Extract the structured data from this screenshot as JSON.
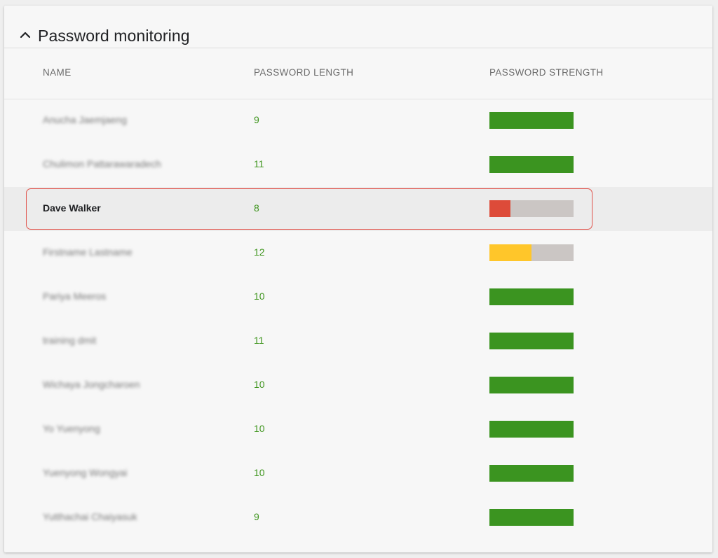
{
  "section": {
    "title": "Password monitoring",
    "collapse_icon": "chevron-up-icon"
  },
  "table": {
    "columns": [
      "NAME",
      "PASSWORD LENGTH",
      "PASSWORD STRENGTH"
    ],
    "rows": [
      {
        "name": "Anucha Jaemjaeng",
        "length": "9",
        "strength": 1.0,
        "color": "#3b9420",
        "blurred": true
      },
      {
        "name": "Chulimon Pattarawaradech",
        "length": "11",
        "strength": 1.0,
        "color": "#3b9420",
        "blurred": true
      },
      {
        "name": "Dave Walker",
        "length": "8",
        "strength": 0.25,
        "color": "#dd4b39",
        "blurred": false,
        "selected": true
      },
      {
        "name": "Firstname Lastname",
        "length": "12",
        "strength": 0.5,
        "color": "#ffc62a",
        "blurred": true
      },
      {
        "name": "Pariya Meeros",
        "length": "10",
        "strength": 1.0,
        "color": "#3b9420",
        "blurred": true
      },
      {
        "name": "training dmit",
        "length": "11",
        "strength": 1.0,
        "color": "#3b9420",
        "blurred": true
      },
      {
        "name": "Wichaya Jongcharoen",
        "length": "10",
        "strength": 1.0,
        "color": "#3b9420",
        "blurred": true
      },
      {
        "name": "Yo Yuenyong",
        "length": "10",
        "strength": 1.0,
        "color": "#3b9420",
        "blurred": true
      },
      {
        "name": "Yuenyong Wongyai",
        "length": "10",
        "strength": 1.0,
        "color": "#3b9420",
        "blurred": true
      },
      {
        "name": "Yutthachai Chaiyasuk",
        "length": "9",
        "strength": 1.0,
        "color": "#3b9420",
        "blurred": true
      }
    ]
  },
  "colors": {
    "strong": "#3b9420",
    "weak": "#dd4b39",
    "medium": "#ffc62a",
    "bar_track": "#cbc6c4",
    "highlight_border": "#e0524a",
    "length_text": "#3f951e"
  }
}
